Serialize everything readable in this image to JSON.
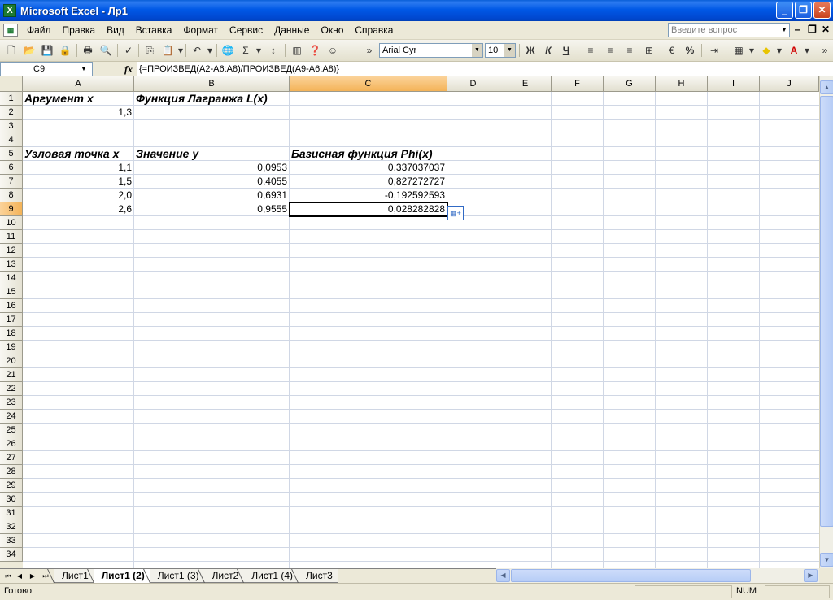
{
  "window": {
    "title": "Microsoft Excel - Лр1",
    "minimize": "_",
    "restore": "❐",
    "close": "✕"
  },
  "menu": {
    "items": [
      "Файл",
      "Правка",
      "Вид",
      "Вставка",
      "Формат",
      "Сервис",
      "Данные",
      "Окно",
      "Справка"
    ],
    "help_placeholder": "Введите вопрос"
  },
  "toolbar": {
    "font_name": "Arial Cyr",
    "font_size": "10",
    "bold": "Ж",
    "italic": "К",
    "underline": "Ч",
    "percent": "%"
  },
  "formula_bar": {
    "name_box": "C9",
    "fx": "fx",
    "formula": "{=ПРОИЗВЕД(A2-A6:A8)/ПРОИЗВЕД(A9-A6:A8)}"
  },
  "columns": [
    "A",
    "B",
    "C",
    "D",
    "E",
    "F",
    "G",
    "H",
    "I",
    "J"
  ],
  "rows": [
    "1",
    "2",
    "3",
    "4",
    "5",
    "6",
    "7",
    "8",
    "9",
    "10",
    "11",
    "12",
    "13",
    "14",
    "15",
    "16",
    "17",
    "18",
    "19",
    "20",
    "21",
    "22",
    "23",
    "24",
    "25",
    "26",
    "27",
    "28",
    "29",
    "30",
    "31",
    "32",
    "33",
    "34"
  ],
  "cells": {
    "A1": "Аргумент x",
    "B1": "Функция Лагранжа L(x)",
    "A2": "1,3",
    "A5": "Узловая точка x",
    "B5": "Значение y",
    "C5": "Базисная функция Phi(x)",
    "A6": "1,1",
    "B6": "0,0953",
    "C6": "0,337037037",
    "A7": "1,5",
    "B7": "0,4055",
    "C7": "0,827272727",
    "A8": "2,0",
    "B8": "0,6931",
    "C8": "-0,192592593",
    "A9": "2,6",
    "B9": "0,9555",
    "C9": "0,028282828"
  },
  "sheet_tabs": [
    "Лист1",
    "Лист1 (2)",
    "Лист1 (3)",
    "Лист2",
    "Лист1 (4)",
    "Лист3"
  ],
  "active_tab": "Лист1 (2)",
  "status": {
    "ready": "Готово",
    "num": "NUM"
  }
}
